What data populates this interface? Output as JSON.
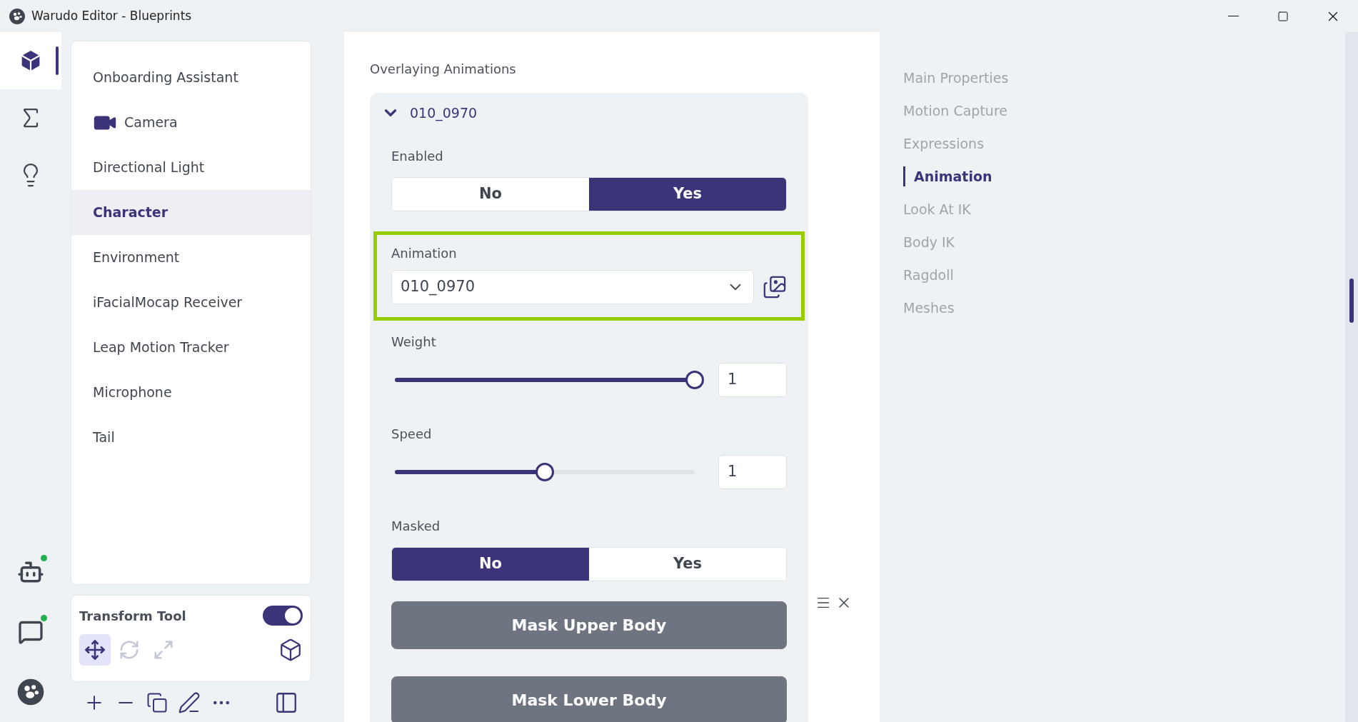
{
  "window": {
    "title": "Warudo Editor - Blueprints"
  },
  "rail": {
    "top": [
      {
        "kind": "cube",
        "selected": true
      },
      {
        "kind": "sigma",
        "selected": false
      },
      {
        "kind": "bulb",
        "selected": false
      }
    ],
    "bottom": [
      {
        "kind": "robot",
        "online": true
      },
      {
        "kind": "bubble",
        "online": true
      },
      {
        "kind": "logo"
      }
    ]
  },
  "sidebar": {
    "items": [
      {
        "label": "Onboarding Assistant",
        "kind": "plain",
        "selected": false
      },
      {
        "label": "Camera",
        "kind": "camera",
        "selected": false
      },
      {
        "label": "Directional Light",
        "kind": "plain",
        "selected": false
      },
      {
        "label": "Character",
        "kind": "plain",
        "selected": true
      },
      {
        "label": "Environment",
        "kind": "plain",
        "selected": false
      },
      {
        "label": "iFacialMocap Receiver",
        "kind": "plain",
        "selected": false
      },
      {
        "label": "Leap Motion Tracker",
        "kind": "plain",
        "selected": false
      },
      {
        "label": "Microphone",
        "kind": "plain",
        "selected": false
      },
      {
        "label": "Tail",
        "kind": "plain",
        "selected": false
      }
    ]
  },
  "transform_tool": {
    "label": "Transform Tool",
    "on": true,
    "modes": [
      {
        "kind": "move",
        "selected": true
      },
      {
        "kind": "rotate",
        "selected": false
      },
      {
        "kind": "scale",
        "selected": false
      }
    ]
  },
  "content": {
    "section_title": "Overlaying Animations",
    "group": {
      "title": "010_0970",
      "expanded": true,
      "fields": [
        {
          "kind": "toggle",
          "label": "Enabled",
          "options": [
            {
              "label": "No",
              "selected": false
            },
            {
              "label": "Yes",
              "selected": true
            }
          ]
        },
        {
          "kind": "dropdown",
          "label": "Animation",
          "value": "010_0970",
          "highlighted": true
        },
        {
          "kind": "slider",
          "label": "Weight",
          "level": 1,
          "value": "1"
        },
        {
          "kind": "slider",
          "label": "Speed",
          "level": 0.5,
          "value": "1"
        },
        {
          "kind": "toggle",
          "label": "Masked",
          "options": [
            {
              "label": "No",
              "selected": true
            },
            {
              "label": "Yes",
              "selected": false
            }
          ]
        },
        {
          "kind": "button",
          "label": "Mask Upper Body"
        },
        {
          "kind": "button",
          "label": "Mask Lower Body"
        }
      ]
    }
  },
  "nav": {
    "items": [
      {
        "label": "Main Properties",
        "selected": false
      },
      {
        "label": "Motion Capture",
        "selected": false
      },
      {
        "label": "Expressions",
        "selected": false
      },
      {
        "label": "Animation",
        "selected": true
      },
      {
        "label": "Look At IK",
        "selected": false
      },
      {
        "label": "Body IK",
        "selected": false
      },
      {
        "label": "Ragdoll",
        "selected": false
      },
      {
        "label": "Meshes",
        "selected": false
      }
    ]
  }
}
